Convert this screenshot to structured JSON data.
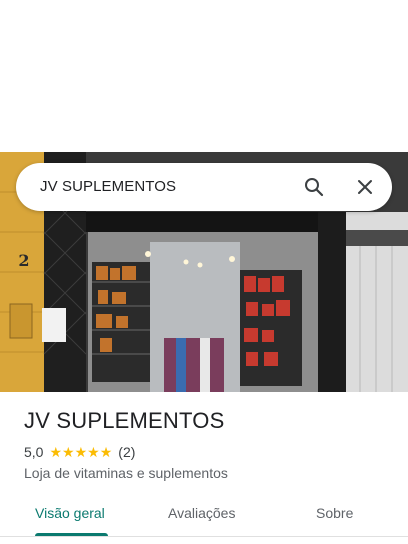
{
  "search": {
    "query": "JV SUPLEMENTOS"
  },
  "place": {
    "name": "JV SUPLEMENTOS",
    "rating": "5,0",
    "stars": 5,
    "review_count": "(2)",
    "category": "Loja de vitaminas e suplementos"
  },
  "photo": {
    "house_number": "2"
  },
  "tabs": [
    {
      "label": "Visão geral",
      "active": true
    },
    {
      "label": "Avaliações",
      "active": false
    },
    {
      "label": "Sobre",
      "active": false
    }
  ],
  "colors": {
    "accent": "#0b7a6f",
    "star": "#fbbc04"
  }
}
